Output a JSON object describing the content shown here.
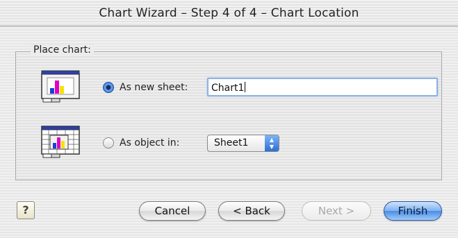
{
  "window": {
    "title": "Chart Wizard – Step 4 of 4 – Chart Location"
  },
  "place_chart": {
    "group_label": "Place chart:",
    "new_sheet": {
      "label": "As new sheet:",
      "selected": true,
      "value": "Chart1",
      "icon": "chart-sheet-icon"
    },
    "as_object": {
      "label": "As object in:",
      "selected": false,
      "value": "Sheet1",
      "icon": "embedded-chart-icon"
    }
  },
  "buttons": {
    "help": "?",
    "cancel": "Cancel",
    "back": "< Back",
    "next": "Next >",
    "finish": "Finish"
  },
  "colors": {
    "accent": "#4a8de6",
    "bar_blue": "#1f3fd6",
    "bar_magenta": "#e000c8",
    "bar_yellow": "#f5e400"
  }
}
